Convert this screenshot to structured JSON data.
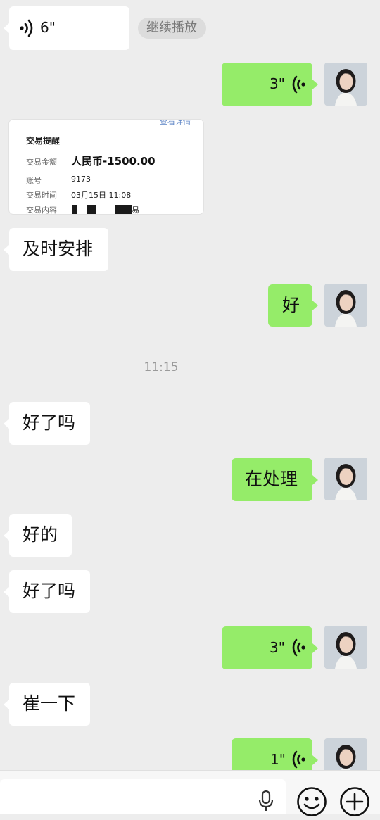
{
  "messages": {
    "voice_in": {
      "duration": "6\""
    },
    "continue_play": "继续播放",
    "voice_out_1": {
      "duration": "3\""
    },
    "card": {
      "corner_text": "查看详情",
      "title": "交易提醒",
      "amount_label": "交易金额",
      "amount_value": "人民币-1500.00",
      "account_label": "账号",
      "account_value": "9173",
      "time_label": "交易时间",
      "time_value": "03月15日 11:08",
      "content_label": "交易内容",
      "content_tail": "易"
    },
    "in_1": "及时安排",
    "out_1": "好",
    "timestamp": "11:15",
    "in_2": "好了吗",
    "out_2": "在处理",
    "in_3": "好的",
    "in_4": "好了吗",
    "voice_out_2": {
      "duration": "3\""
    },
    "in_5": "崔一下",
    "voice_out_3": {
      "duration": "1\""
    }
  },
  "colors": {
    "background": "#ededed",
    "incoming_bubble": "#ffffff",
    "outgoing_bubble": "#95ec69",
    "input_bar": "#f7f7f7"
  },
  "icons": {
    "voice": "voice-wave-icon",
    "avatar": "avatar-portrait",
    "mic": "microphone-icon",
    "emoji": "emoji-icon",
    "plus": "plus-icon"
  }
}
